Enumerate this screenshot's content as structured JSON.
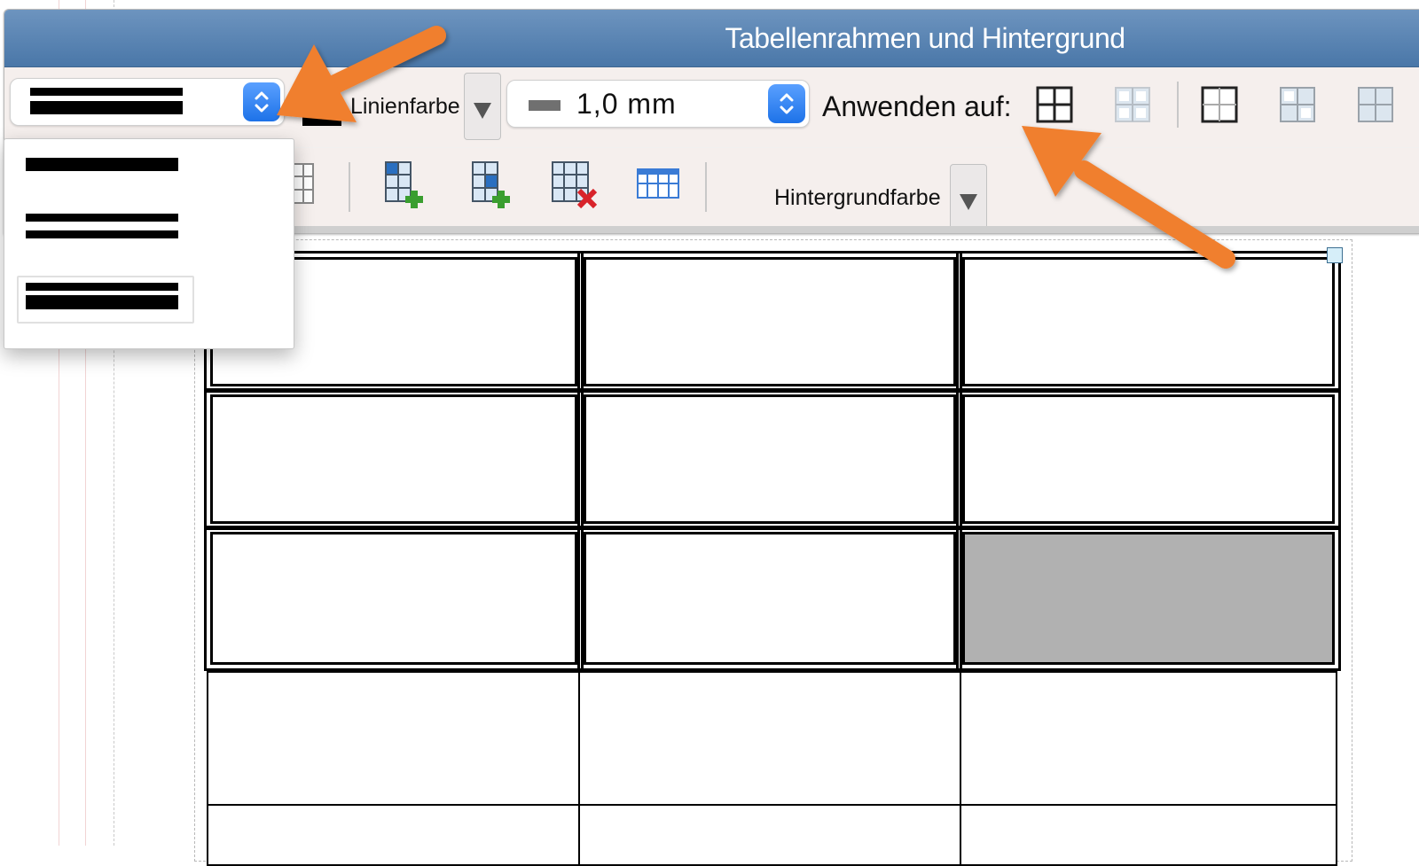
{
  "window": {
    "title": "Tabellenrahmen und Hintergrund"
  },
  "toolbar": {
    "line_style_control": "line-style-popup",
    "line_color_label": "Linienfarbe",
    "line_width_value": "1,0 mm",
    "apply_to_label": "Anwenden auf:",
    "background_color_label": "Hintergrundfarbe"
  },
  "line_style_menu": {
    "items": [
      "single-thick",
      "double-thin",
      "double-thick"
    ],
    "selected_index": 2
  },
  "table": {
    "rows": 5,
    "columns": 3,
    "shaded_cell": {
      "row": 3,
      "column": 3
    },
    "shade_color": "#b1b1b1"
  },
  "colors": {
    "title_bar": "#5b86b5",
    "accent_blue": "#1d72e8",
    "annotation_arrow": "#f07f2f"
  },
  "icons": [
    "grid-all-borders-icon",
    "grid-inner-borders-icon",
    "grid-outer-borders-icon",
    "insert-row-icon",
    "insert-column-icon",
    "delete-cells-icon",
    "table-header-icon"
  ]
}
